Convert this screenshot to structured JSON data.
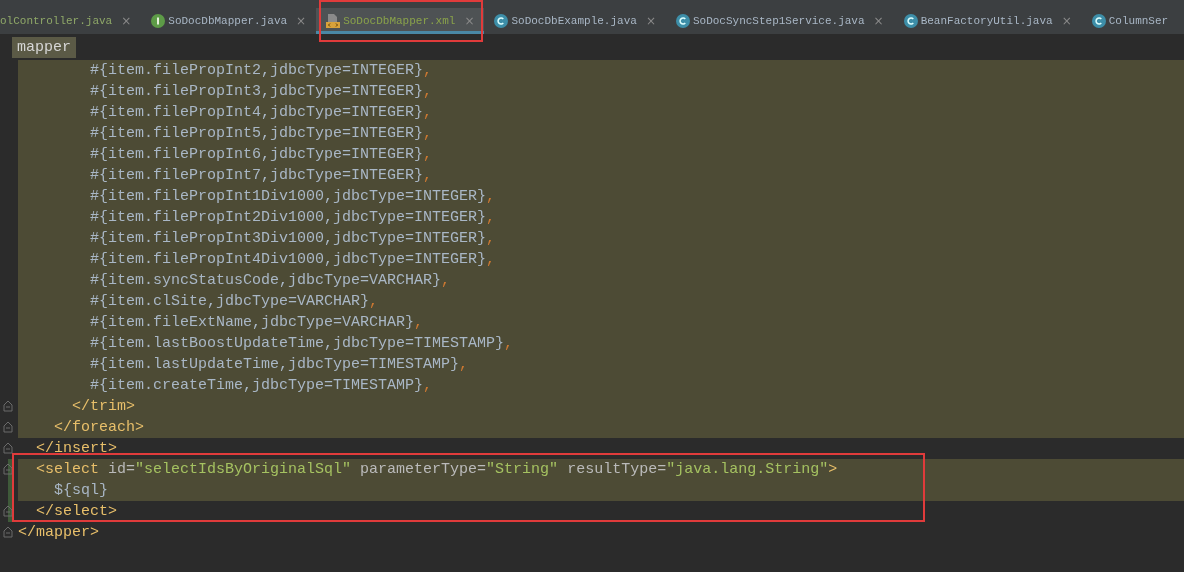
{
  "tabs": [
    {
      "label": "olController.java",
      "kind": "none",
      "selected": false,
      "closable": true,
      "annotated": false
    },
    {
      "label": "SoDocDbMapper.java",
      "kind": "interface",
      "selected": false,
      "closable": true,
      "annotated": false
    },
    {
      "label": "SoDocDbMapper.xml",
      "kind": "xml",
      "selected": true,
      "closable": true,
      "annotated": true
    },
    {
      "label": "SoDocDbExample.java",
      "kind": "class",
      "selected": false,
      "closable": true,
      "annotated": false
    },
    {
      "label": "SoDocSyncStep1Service.java",
      "kind": "class",
      "selected": false,
      "closable": true,
      "annotated": false
    },
    {
      "label": "BeanFactoryUtil.java",
      "kind": "class",
      "selected": false,
      "closable": true,
      "annotated": false
    },
    {
      "label": "ColumnSer",
      "kind": "class",
      "selected": false,
      "closable": false,
      "annotated": false
    }
  ],
  "close_glyph": "×",
  "breadcrumb": {
    "label": "mapper"
  },
  "code": [
    {
      "annotated": false,
      "close": {
        "highlighted": false,
        "fold": true,
        "changed": false,
        "tokens": [
          {
            "kind": "tag",
            "text": "</mapper>"
          }
        ]
      },
      "children": [
        {
          "annotated": false,
          "close": {
            "highlighted": false,
            "fold": true,
            "changed": false,
            "tokens": [
              {
                "kind": "tag",
                "text": "</insert>"
              }
            ]
          },
          "children": [
            {
              "annotated": false,
              "close": {
                "highlighted": true,
                "fold": true,
                "changed": false,
                "tokens": [
                  {
                    "kind": "tag",
                    "text": "</foreach>"
                  }
                ]
              },
              "children": [
                {
                  "annotated": false,
                  "close": {
                    "highlighted": true,
                    "fold": true,
                    "changed": false,
                    "tokens": [
                      {
                        "kind": "tag",
                        "text": "</trim>"
                      }
                    ]
                  },
                  "children": [
                    {
                      "line": {
                        "highlighted": true,
                        "fold": false,
                        "changed": false,
                        "tokens": [
                          {
                            "kind": "text",
                            "text": "#{item.filePropInt2,jdbcType=INTEGER}"
                          },
                          {
                            "kind": "punct",
                            "text": ","
                          }
                        ]
                      }
                    },
                    {
                      "line": {
                        "highlighted": true,
                        "fold": false,
                        "changed": false,
                        "tokens": [
                          {
                            "kind": "text",
                            "text": "#{item.filePropInt3,jdbcType=INTEGER}"
                          },
                          {
                            "kind": "punct",
                            "text": ","
                          }
                        ]
                      }
                    },
                    {
                      "line": {
                        "highlighted": true,
                        "fold": false,
                        "changed": false,
                        "tokens": [
                          {
                            "kind": "text",
                            "text": "#{item.filePropInt4,jdbcType=INTEGER}"
                          },
                          {
                            "kind": "punct",
                            "text": ","
                          }
                        ]
                      }
                    },
                    {
                      "line": {
                        "highlighted": true,
                        "fold": false,
                        "changed": false,
                        "tokens": [
                          {
                            "kind": "text",
                            "text": "#{item.filePropInt5,jdbcType=INTEGER}"
                          },
                          {
                            "kind": "punct",
                            "text": ","
                          }
                        ]
                      }
                    },
                    {
                      "line": {
                        "highlighted": true,
                        "fold": false,
                        "changed": false,
                        "tokens": [
                          {
                            "kind": "text",
                            "text": "#{item.filePropInt6,jdbcType=INTEGER}"
                          },
                          {
                            "kind": "punct",
                            "text": ","
                          }
                        ]
                      }
                    },
                    {
                      "line": {
                        "highlighted": true,
                        "fold": false,
                        "changed": false,
                        "tokens": [
                          {
                            "kind": "text",
                            "text": "#{item.filePropInt7,jdbcType=INTEGER}"
                          },
                          {
                            "kind": "punct",
                            "text": ","
                          }
                        ]
                      }
                    },
                    {
                      "line": {
                        "highlighted": true,
                        "fold": false,
                        "changed": false,
                        "tokens": [
                          {
                            "kind": "text",
                            "text": "#{item.filePropInt1Div1000,jdbcType=INTEGER}"
                          },
                          {
                            "kind": "punct",
                            "text": ","
                          }
                        ]
                      }
                    },
                    {
                      "line": {
                        "highlighted": true,
                        "fold": false,
                        "changed": false,
                        "tokens": [
                          {
                            "kind": "text",
                            "text": "#{item.filePropInt2Div1000,jdbcType=INTEGER}"
                          },
                          {
                            "kind": "punct",
                            "text": ","
                          }
                        ]
                      }
                    },
                    {
                      "line": {
                        "highlighted": true,
                        "fold": false,
                        "changed": false,
                        "tokens": [
                          {
                            "kind": "text",
                            "text": "#{item.filePropInt3Div1000,jdbcType=INTEGER}"
                          },
                          {
                            "kind": "punct",
                            "text": ","
                          }
                        ]
                      }
                    },
                    {
                      "line": {
                        "highlighted": true,
                        "fold": false,
                        "changed": false,
                        "tokens": [
                          {
                            "kind": "text",
                            "text": "#{item.filePropInt4Div1000,jdbcType=INTEGER}"
                          },
                          {
                            "kind": "punct",
                            "text": ","
                          }
                        ]
                      }
                    },
                    {
                      "line": {
                        "highlighted": true,
                        "fold": false,
                        "changed": false,
                        "tokens": [
                          {
                            "kind": "text",
                            "text": "#{item.syncStatusCode,jdbcType=VARCHAR}"
                          },
                          {
                            "kind": "punct",
                            "text": ","
                          }
                        ]
                      }
                    },
                    {
                      "line": {
                        "highlighted": true,
                        "fold": false,
                        "changed": false,
                        "tokens": [
                          {
                            "kind": "text",
                            "text": "#{item.clSite,jdbcType=VARCHAR}"
                          },
                          {
                            "kind": "punct",
                            "text": ","
                          }
                        ]
                      }
                    },
                    {
                      "line": {
                        "highlighted": true,
                        "fold": false,
                        "changed": false,
                        "tokens": [
                          {
                            "kind": "text",
                            "text": "#{item.fileExtName,jdbcType=VARCHAR}"
                          },
                          {
                            "kind": "punct",
                            "text": ","
                          }
                        ]
                      }
                    },
                    {
                      "line": {
                        "highlighted": true,
                        "fold": false,
                        "changed": false,
                        "tokens": [
                          {
                            "kind": "text",
                            "text": "#{item.lastBoostUpdateTime,jdbcType=TIMESTAMP}"
                          },
                          {
                            "kind": "punct",
                            "text": ","
                          }
                        ]
                      }
                    },
                    {
                      "line": {
                        "highlighted": true,
                        "fold": false,
                        "changed": false,
                        "tokens": [
                          {
                            "kind": "text",
                            "text": "#{item.lastUpdateTime,jdbcType=TIMESTAMP}"
                          },
                          {
                            "kind": "punct",
                            "text": ","
                          }
                        ]
                      }
                    },
                    {
                      "line": {
                        "highlighted": true,
                        "fold": false,
                        "changed": false,
                        "tokens": [
                          {
                            "kind": "text",
                            "text": "#{item.createTime,jdbcType=TIMESTAMP}"
                          },
                          {
                            "kind": "punct",
                            "text": ","
                          }
                        ]
                      }
                    }
                  ]
                }
              ]
            }
          ]
        },
        {
          "annotated": true,
          "open": {
            "highlighted": true,
            "fold": true,
            "changed": true,
            "tokens": [
              {
                "kind": "tag",
                "text": "<select"
              },
              {
                "kind": "attr",
                "text": " id="
              },
              {
                "kind": "value",
                "text": "\"selectIdsByOriginalSql\""
              },
              {
                "kind": "attr",
                "text": " parameterType="
              },
              {
                "kind": "value",
                "text": "\"String\""
              },
              {
                "kind": "attr",
                "text": " resultType="
              },
              {
                "kind": "value",
                "text": "\"java.lang.String\""
              },
              {
                "kind": "tag",
                "text": ">"
              }
            ]
          },
          "close": {
            "highlighted": false,
            "fold": true,
            "changed": true,
            "tokens": [
              {
                "kind": "tag",
                "text": "</select>"
              }
            ]
          },
          "children": [
            {
              "line": {
                "highlighted": true,
                "fold": false,
                "changed": true,
                "tokens": [
                  {
                    "kind": "text",
                    "text": "${sql}"
                  }
                ]
              }
            }
          ]
        }
      ]
    }
  ]
}
